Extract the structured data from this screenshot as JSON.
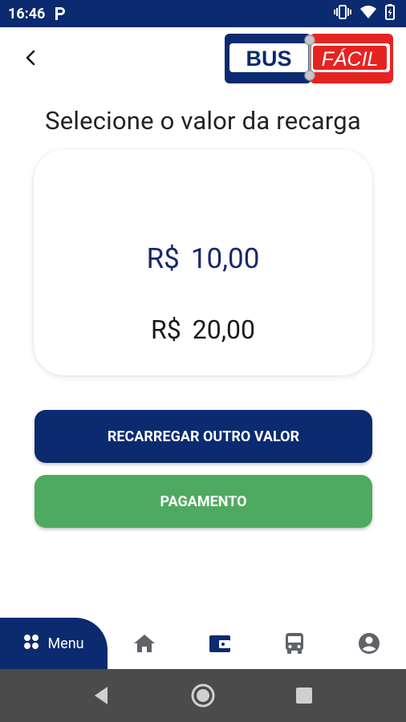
{
  "status_bar": {
    "time": "16:46",
    "notification_icon": "parking-p-icon"
  },
  "header": {
    "logo_left": "BUS",
    "logo_right": "FÁCIL"
  },
  "page": {
    "title": "Selecione o valor da recarga"
  },
  "values": [
    {
      "currency": "R$",
      "amount": "10,00",
      "selected": true
    },
    {
      "currency": "R$",
      "amount": "20,00",
      "selected": false
    }
  ],
  "buttons": {
    "other_value": "RECARREGAR OUTRO VALOR",
    "payment": "PAGAMENTO"
  },
  "bottom_nav": {
    "menu_label": "Menu",
    "items": [
      "home-icon",
      "wallet-icon",
      "bus-icon",
      "account-icon"
    ]
  },
  "colors": {
    "primary": "#0b2a6f",
    "success": "#4eaa60",
    "accent_red": "#e52421",
    "selected_text": "#17296b"
  }
}
